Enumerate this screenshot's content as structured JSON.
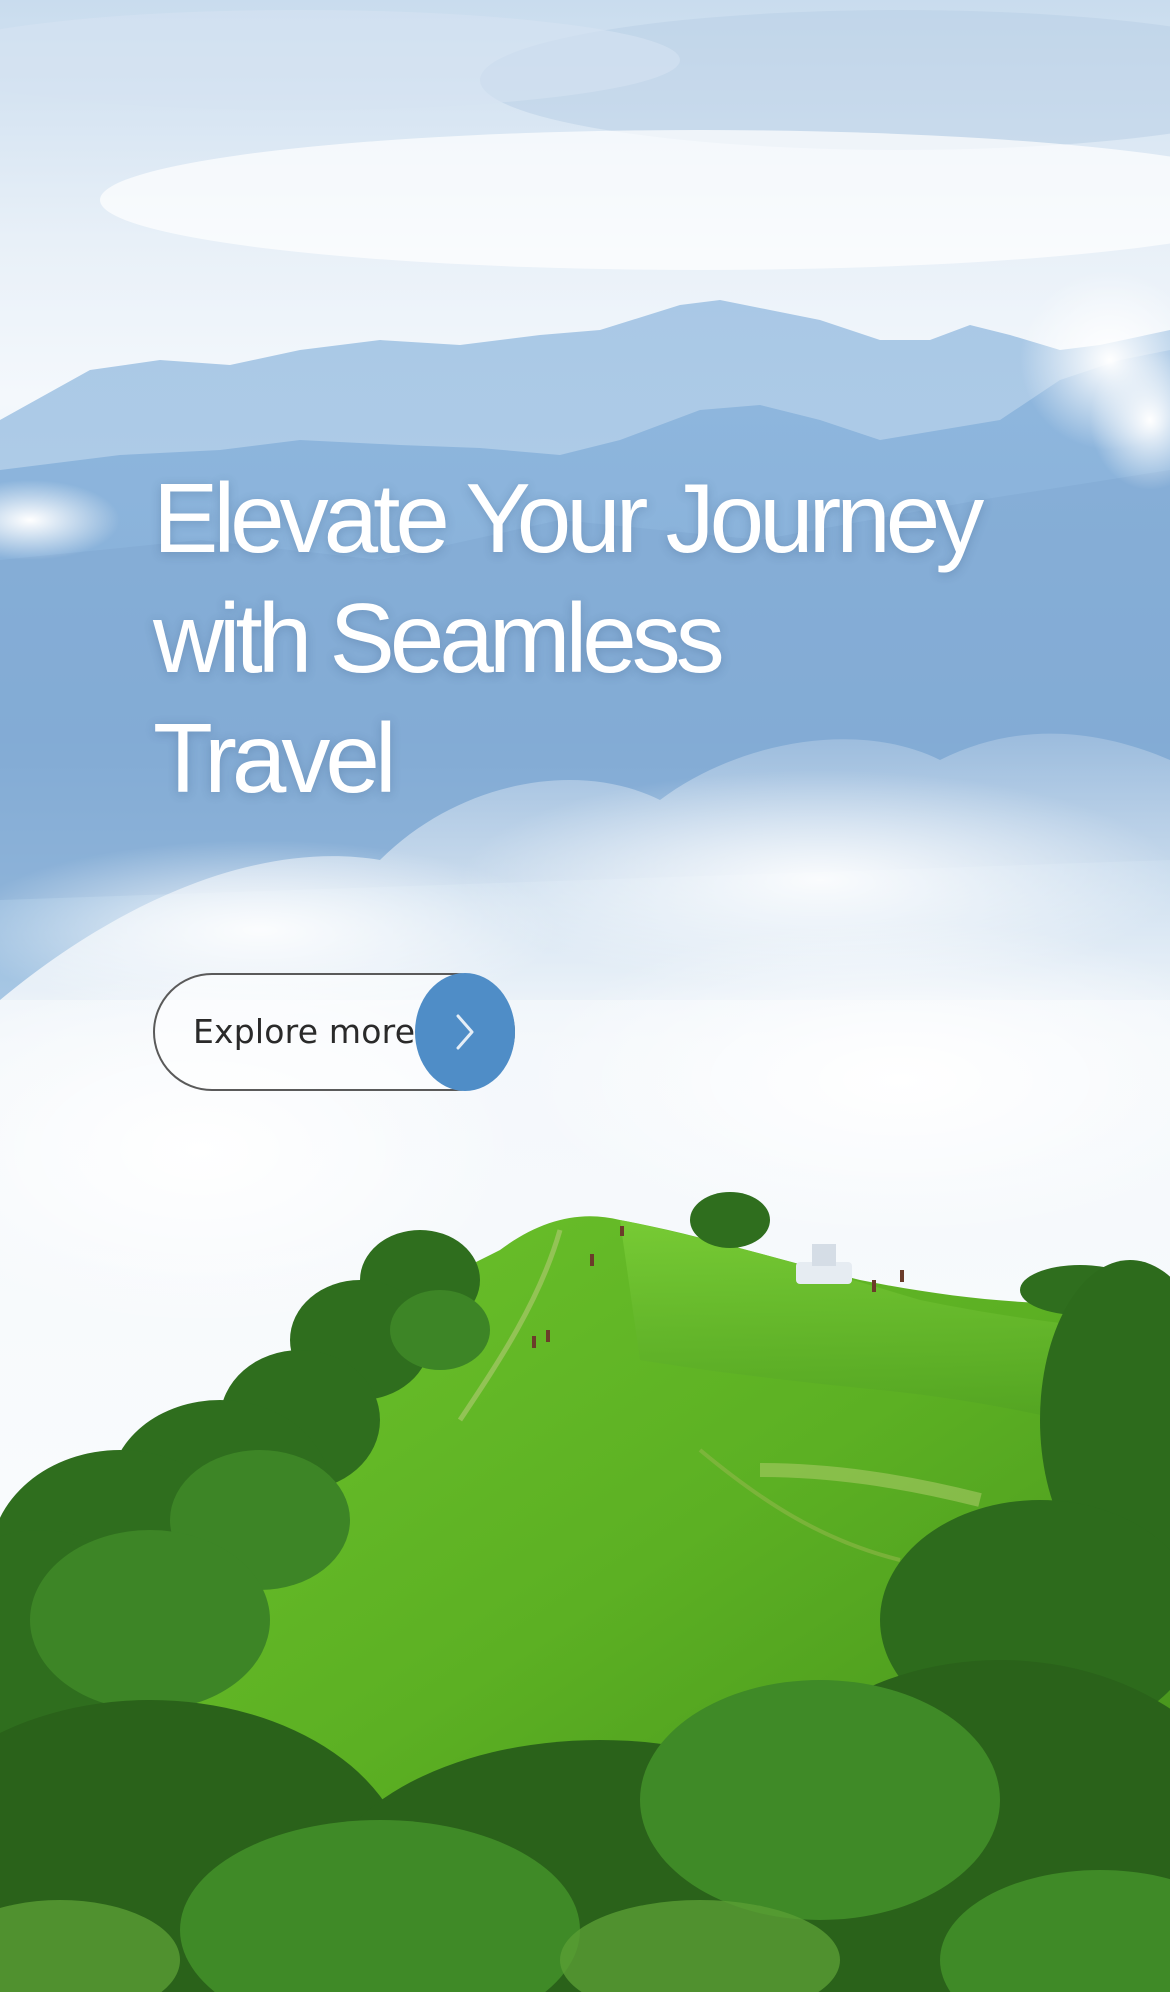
{
  "hero": {
    "headline_lines": [
      "Elevate Your Journey",
      "with Seamless",
      "Travel"
    ],
    "cta": {
      "label": "Explore more",
      "icon": "chevron-right-icon",
      "accent_color": "#4f8dc7"
    }
  }
}
